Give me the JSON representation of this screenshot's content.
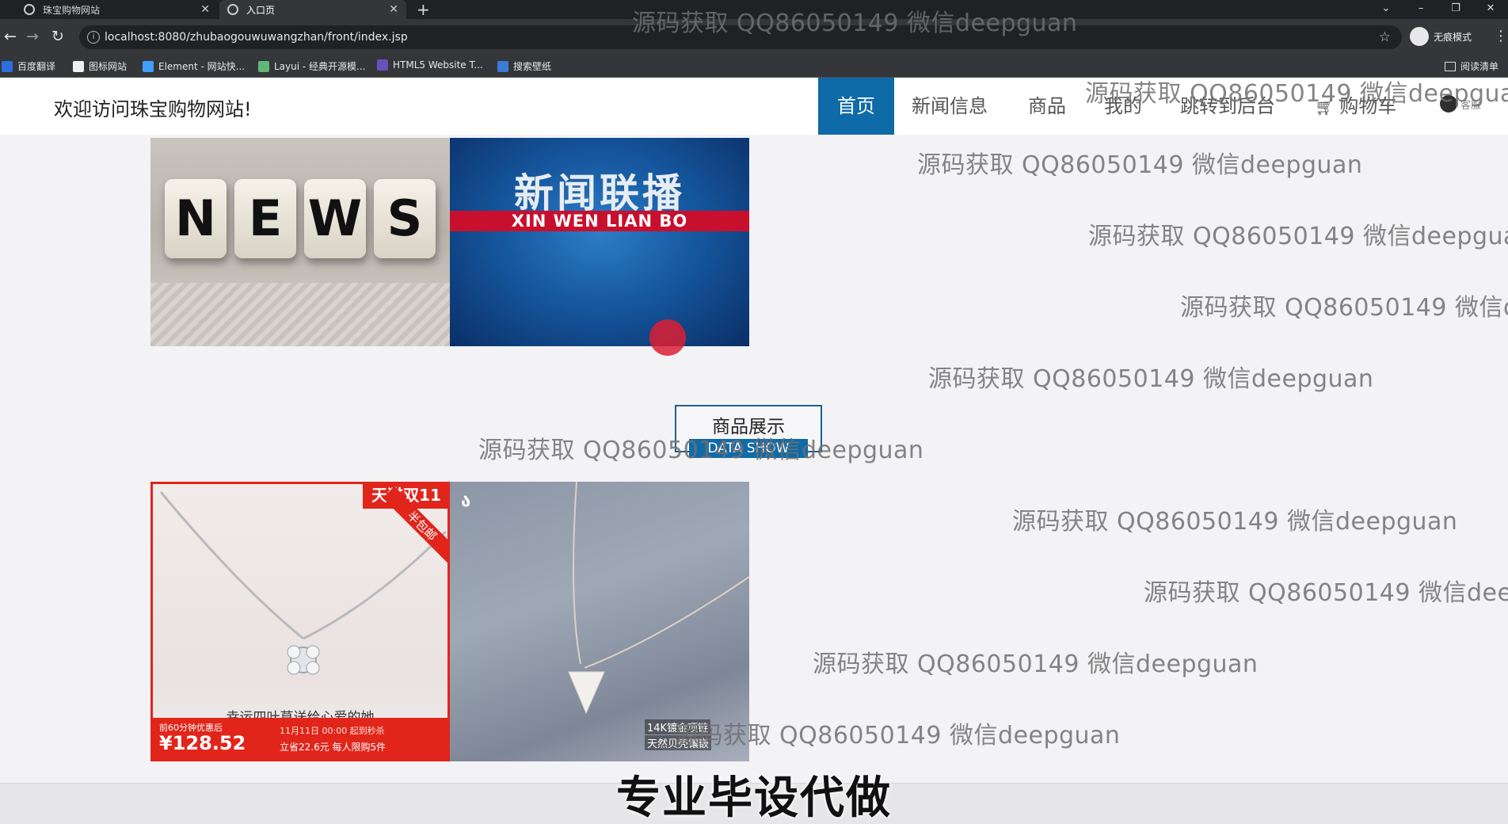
{
  "browser": {
    "tabs": [
      {
        "label": "珠宝购物网站"
      },
      {
        "label": "入口页"
      }
    ],
    "new_tab": "+",
    "window_controls": [
      "⌄",
      "–",
      "❐",
      "✕"
    ],
    "url": "localhost:8080/zhubaogouwuwangzhan/front/index.jsp",
    "incognito_label": "无痕模式",
    "bookmarks": [
      "百度翻译",
      "图标网站",
      "Element - 网站快...",
      "Layui - 经典开源模...",
      "HTML5 Website T...",
      "搜索壁纸"
    ],
    "reading_list": "阅读清单"
  },
  "header": {
    "site_title": "欢迎访问珠宝购物网站!",
    "nav": [
      "首页",
      "新闻信息",
      "商品",
      "我的",
      "跳转到后台",
      "购物车"
    ],
    "service_label": "客服"
  },
  "banner": {
    "news_letters": [
      "N",
      "E",
      "W",
      "S"
    ],
    "xwlb_cn": "新闻联播",
    "xwlb_en": "XIN WEN LIAN BO"
  },
  "section": {
    "title_cn": "商品展示",
    "title_en": "DATA SHOW"
  },
  "products": {
    "p1": {
      "tag": "天猫双11",
      "corner": "半包邮",
      "slogan": "幸运四叶草送给心爱的她",
      "pre_label": "前60分钟优惠后",
      "price": "¥128.52",
      "sub_line1": "11月11日 00:00 起到秒杀",
      "sub_line2": "立省22.6元 每人限购5件"
    },
    "p2": {
      "logo": "ა",
      "text1": "14K镀金项链",
      "text2": "天然贝壳镶嵌"
    }
  },
  "watermark": "源码获取 QQ86050149 微信deepguan",
  "caption": "专业毕设代做",
  "colors": {
    "nav_active": "#0f6aa8",
    "tab_strip": "#202124",
    "toolbar": "#35363a",
    "promo_red": "#e1251b"
  }
}
